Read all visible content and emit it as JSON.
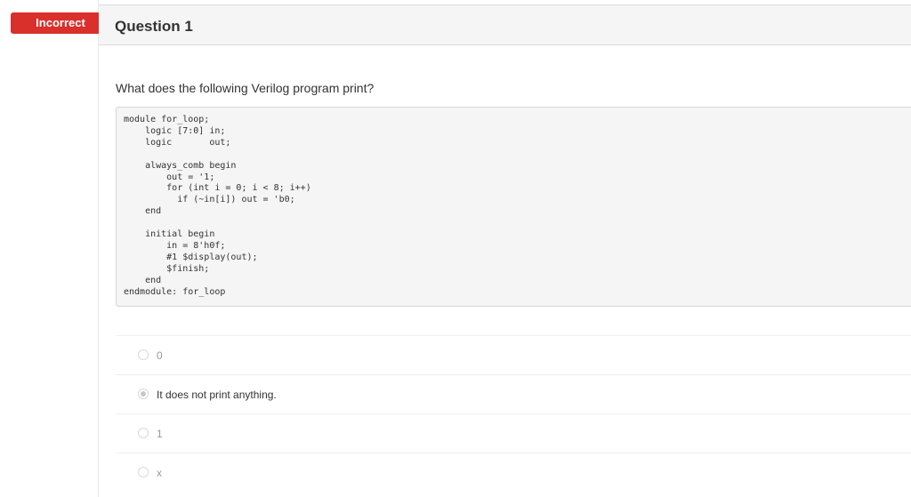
{
  "status_badge": "Incorrect",
  "question": {
    "title": "Question 1",
    "prompt": "What does the following Verilog program print?",
    "code": "module for_loop;\n    logic [7:0] in;\n    logic       out;\n\n    always_comb begin\n        out = '1;\n        for (int i = 0; i < 8; i++)\n          if (~in[i]) out = 'b0;\n    end\n\n    initial begin\n        in = 8'h0f;\n        #1 $display(out);\n        $finish;\n    end\nendmodule: for_loop"
  },
  "options": [
    {
      "label": "0",
      "selected": false
    },
    {
      "label": "It does not print anything.",
      "selected": true
    },
    {
      "label": "1",
      "selected": false
    },
    {
      "label": "x",
      "selected": false
    }
  ],
  "colors": {
    "badge": "#d9302c"
  }
}
